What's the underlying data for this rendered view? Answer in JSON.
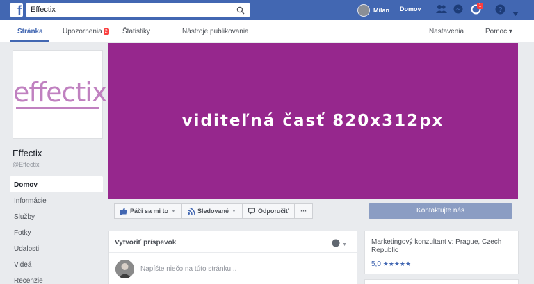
{
  "topbar": {
    "search_value": "Effectix",
    "user_name": "Milan",
    "home_label": "Domov",
    "notification_count": "1"
  },
  "subnav": {
    "tabs": [
      "Stránka",
      "Upozornenia",
      "Štatistiky",
      "Nástroje publikovania"
    ],
    "notifications_badge": "2",
    "settings_label": "Nastavenia",
    "help_label": "Pomoc ▾"
  },
  "profile": {
    "logo_text": "effectix",
    "name": "Effectix",
    "handle": "@Effectix"
  },
  "menu": {
    "items": [
      "Domov",
      "Informácie",
      "Služby",
      "Fotky",
      "Udalosti",
      "Videá",
      "Recenzie"
    ]
  },
  "cover": {
    "text": "viditeľná časť 820x312px",
    "color": "#96278d"
  },
  "actions": {
    "like_label": "Páči sa mi to",
    "follow_label": "Sledované",
    "share_label": "Odporučiť",
    "more_label": "···",
    "contact_label": "Kontaktujte nás"
  },
  "post": {
    "title": "Vytvoriť príspevok",
    "placeholder": "Napíšte niečo na túto stránku..."
  },
  "info": {
    "text": "Marketingový konzultant v: Prague, Czech Republic",
    "rating": "5,0",
    "stars": "★★★★★"
  }
}
